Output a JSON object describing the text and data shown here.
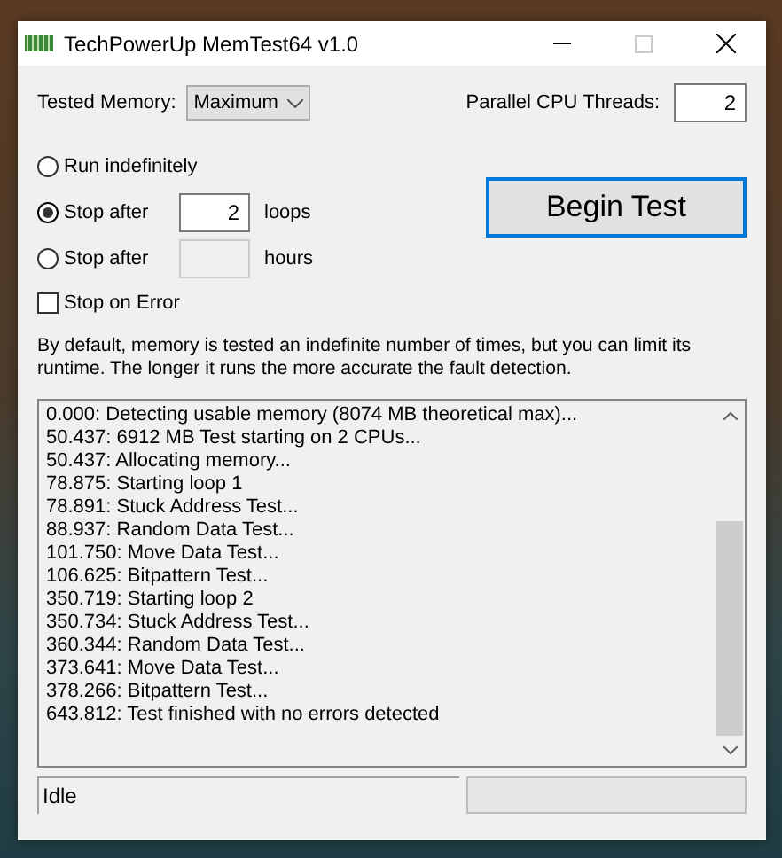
{
  "window": {
    "title": "TechPowerUp MemTest64 v1.0"
  },
  "tested_memory": {
    "label": "Tested Memory:",
    "value": "Maximum"
  },
  "threads": {
    "label": "Parallel CPU Threads:",
    "value": "2"
  },
  "run_modes": [
    {
      "label": "Run indefinitely",
      "selected": false
    },
    {
      "label": "Stop after",
      "selected": true,
      "value": "2",
      "unit": "loops",
      "disabled": false
    },
    {
      "label": "Stop after",
      "selected": false,
      "unit": "hours",
      "disabled": true
    }
  ],
  "stop_on_error": {
    "label": "Stop on Error",
    "checked": false
  },
  "begin_button": {
    "label": "Begin Test"
  },
  "description": "By default, memory is tested an indefinite number of times, but you can limit its runtime. The longer it runs the more accurate the fault detection.",
  "log": [
    "0.000: Detecting usable memory (8074 MB theoretical max)...",
    "50.437: 6912 MB Test starting on 2 CPUs...",
    "50.437: Allocating memory...",
    "78.875: Starting loop 1",
    "78.891: Stuck Address Test...",
    "88.937: Random Data Test...",
    "101.750: Move Data Test...",
    "106.625: Bitpattern Test...",
    "350.719: Starting loop 2",
    "350.734: Stuck Address Test...",
    "360.344: Random Data Test...",
    "373.641: Move Data Test...",
    "378.266: Bitpattern Test...",
    "643.812: Test finished with no errors detected"
  ],
  "status_bar": {
    "text": "Idle"
  }
}
